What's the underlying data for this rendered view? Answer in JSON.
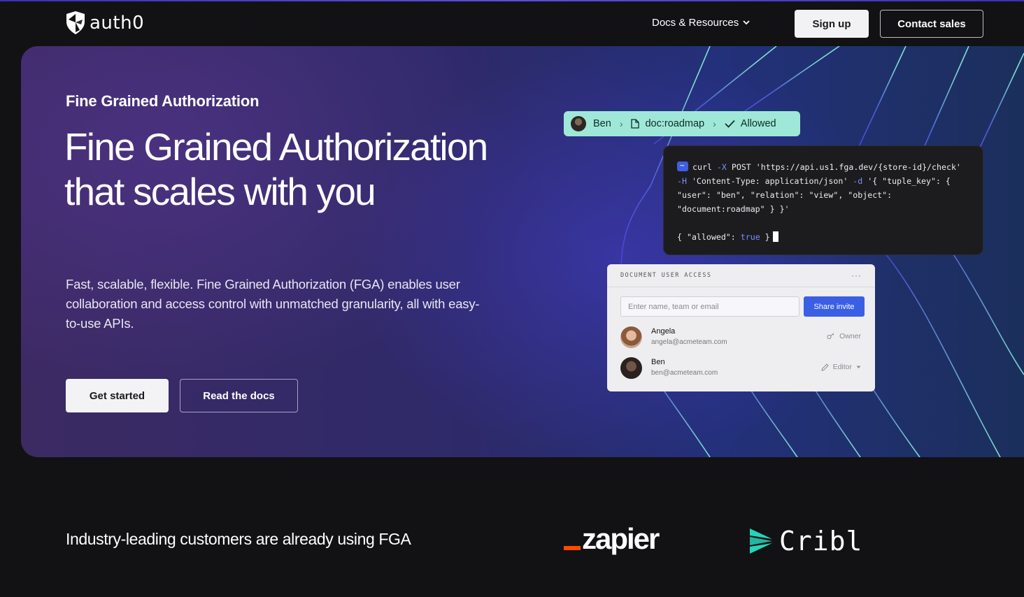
{
  "nav": {
    "logo_text": "auth0",
    "docs_label": "Docs & Resources",
    "signup_label": "Sign up",
    "contact_label": "Contact sales"
  },
  "hero": {
    "eyebrow": "Fine Grained Authorization",
    "title": "Fine Grained Authorization that scales with you",
    "description": "Fast, scalable, flexible. Fine Grained Authorization (FGA) enables user collaboration and access control with unmatched granularity, all with easy-to-use APIs.",
    "primary_cta": "Get started",
    "secondary_cta": "Read the docs"
  },
  "check_pill": {
    "user": "Ben",
    "object": "doc:roadmap",
    "result": "Allowed"
  },
  "terminal": {
    "lines": [
      {
        "a": "curl ",
        "k": "-X",
        "b": " POST 'https://api.us1.fga.dev/{store-id}/check'"
      },
      {
        "a": "",
        "k": "-H",
        "b": " 'Content-Type: application/json' ",
        "k2": "-d",
        "c": " '{ \"tuple_key\": {"
      },
      {
        "a": "\"user\": \"ben\", \"relation\": \"view\", \"object\":",
        "k": "",
        "b": ""
      },
      {
        "a": "\"document:roadmap\" } }'",
        "k": "",
        "b": ""
      }
    ],
    "response_prefix": "{ \"allowed\": ",
    "response_value": "true",
    "response_suffix": " }"
  },
  "access_card": {
    "title": "DOCUMENT USER ACCESS",
    "more": "···",
    "input_placeholder": "Enter name, team or email",
    "share_label": "Share invite",
    "users": [
      {
        "name": "Angela",
        "email": "angela@acmeteam.com",
        "role": "Owner"
      },
      {
        "name": "Ben",
        "email": "ben@acmeteam.com",
        "role": "Editor"
      }
    ]
  },
  "customers": {
    "heading": "Industry-leading customers are already using FGA",
    "logos": [
      "zapier",
      "Cribl"
    ]
  },
  "colors": {
    "background": "#121214",
    "pill": "#9fe8d8",
    "share_button": "#3a5fe5",
    "zapier_orange": "#ff4a00",
    "cribl_teal": "#25d4b9"
  }
}
